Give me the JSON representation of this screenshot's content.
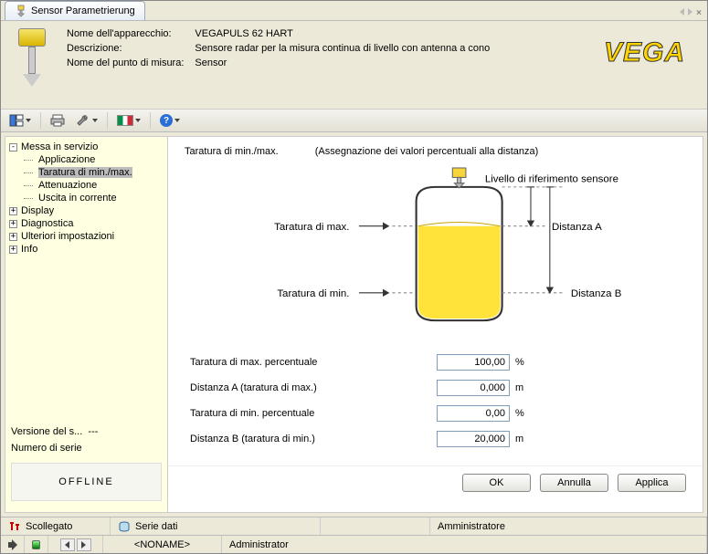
{
  "tab_title": "Sensor Parametrierung",
  "header": {
    "name_label": "Nome dell'apparecchio:",
    "name_value": "VEGAPULS 62 HART",
    "desc_label": "Descrizione:",
    "desc_value": "Sensore radar per la misura continua di livello con antenna a cono",
    "mp_label": "Nome del punto di misura:",
    "mp_value": "Sensor",
    "logo": "VEGA"
  },
  "tree": {
    "items": [
      {
        "label": "Messa in servizio",
        "box": "-"
      },
      {
        "label": "Applicazione",
        "child": true
      },
      {
        "label": "Taratura di min./max.",
        "child": true,
        "selected": true
      },
      {
        "label": "Attenuazione",
        "child": true
      },
      {
        "label": "Uscita in corrente",
        "child": true
      },
      {
        "label": "Display",
        "box": "+"
      },
      {
        "label": "Diagnostica",
        "box": "+"
      },
      {
        "label": "Ulteriori impostazioni",
        "box": "+"
      },
      {
        "label": "Info",
        "box": "+"
      }
    ],
    "version_label": "Versione del s...",
    "version_value": "---",
    "serial_label": "Numero di serie",
    "offline": "OFFLINE"
  },
  "content": {
    "title": "Taratura di min./max.",
    "subtitle": "(Assegnazione dei valori percentuali alla distanza)",
    "diag": {
      "ref_level": "Livello di riferimento sensore",
      "max": "Taratura di max.",
      "min": "Taratura di min.",
      "distA": "Distanza A",
      "distB": "Distanza B"
    },
    "form": {
      "row1": {
        "label": "Taratura di max. percentuale",
        "value": "100,00",
        "unit": "%"
      },
      "row2": {
        "label": "Distanza A (taratura di max.)",
        "value": "0,000",
        "unit": "m"
      },
      "row3": {
        "label": "Taratura di min. percentuale",
        "value": "0,00",
        "unit": "%"
      },
      "row4": {
        "label": "Distanza B (taratura di min.)",
        "value": "20,000",
        "unit": "m"
      }
    },
    "buttons": {
      "ok": "OK",
      "cancel": "Annulla",
      "apply": "Applica"
    }
  },
  "status1": {
    "connected": "Scollegato",
    "series": "Serie dati",
    "admin": "Amministratore"
  },
  "status2": {
    "noname": "<NONAME>",
    "admin": "Administrator"
  }
}
